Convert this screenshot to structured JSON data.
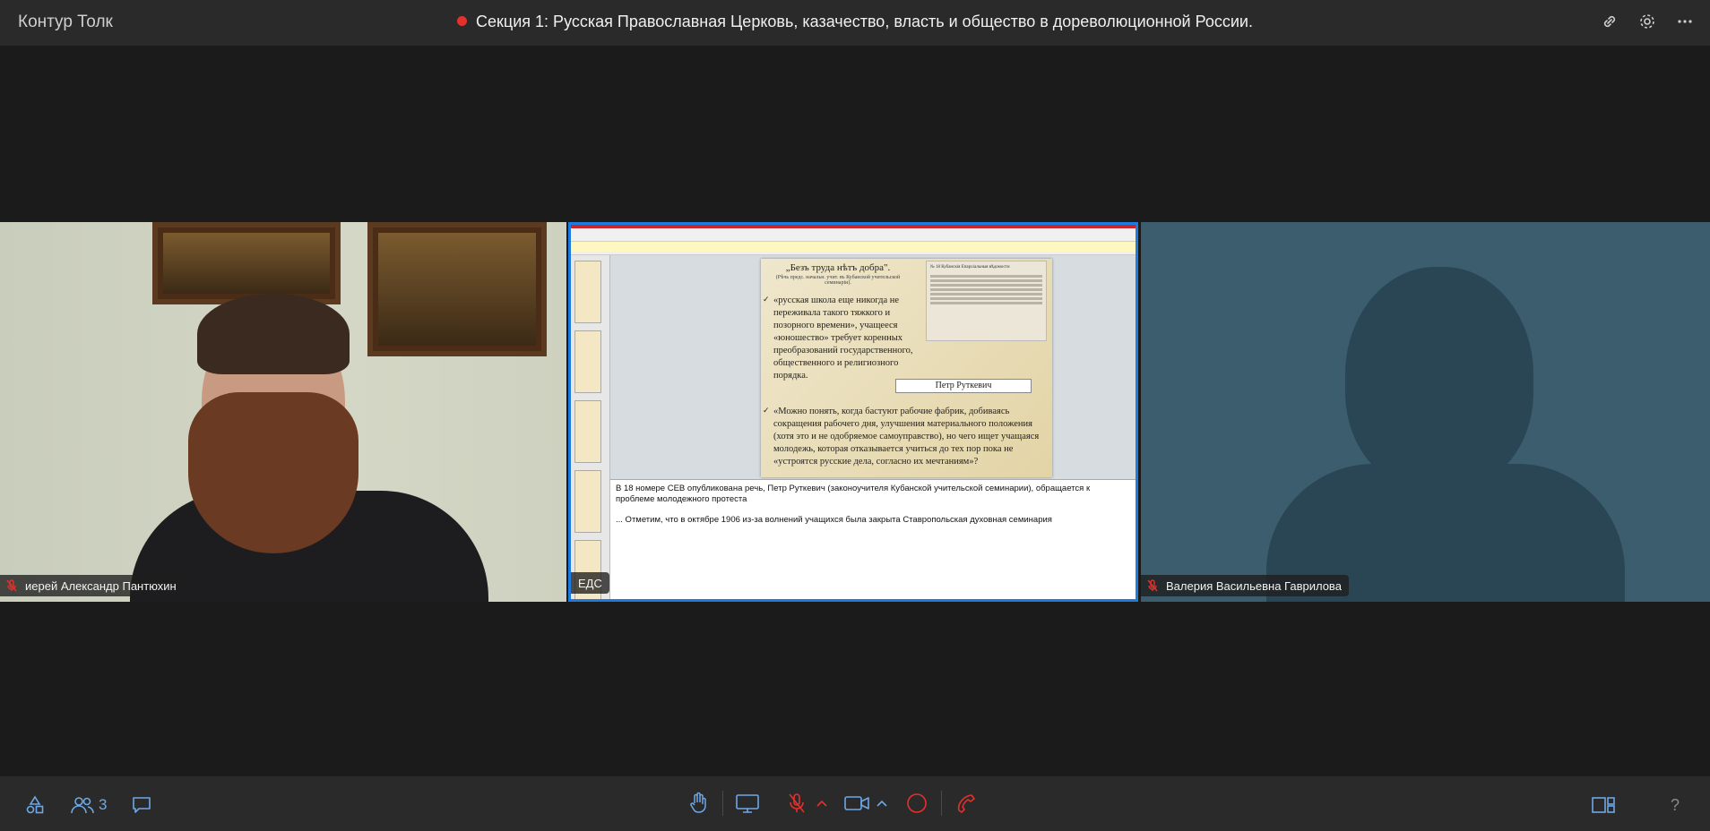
{
  "app": {
    "title": "Контур Толк"
  },
  "meeting": {
    "title": "Секция 1: Русская Православная Церковь, казачество, власть и общество в дореволюционной России.",
    "recording": true
  },
  "participants": {
    "count": "3",
    "tiles": [
      {
        "name": "иерей Александр Пантюхин",
        "mic": "muted"
      },
      {
        "name": "ЕДС",
        "mic": "on",
        "sharing": true
      },
      {
        "name": "Валерия Васильевна Гаврилова",
        "mic": "muted"
      }
    ]
  },
  "shared_slide": {
    "title": "„Безъ труда нѣтъ добра\".",
    "subtitle": "(Рѣчь предс. начальн. учит. въ Кубанской учительской семинаріи).",
    "newspaper_title": "№ 18 Кубанскія Епархіальныя вѣдомости",
    "quote1": "«русская школа еще никогда не переживала такого тяжкого и позорного времени», учащееся «юношество» требует коренных преобразований государственного, общественного и религиозного порядка.",
    "author": "Петр Руткевич",
    "quote2": "«Можно понять, когда бастуют рабочие фабрик, добиваясь сокращения рабочего дня, улучшения материального положения (хотя это и не одобряемое самоуправство), но чего ищет учащаяся молодежь, которая отказывается учиться до тех пор пока не «устроятся русские дела, согласно их мечтаниям»?"
  },
  "notes": {
    "line1": "В 18 номере СЕВ опубликована речь, Петр Руткевич (законоучителя Кубанской учительской семинарии), обращается к проблеме молодежного протеста",
    "line2": "... Отметим, что в октябре 1906 из-за волнений учащихся была закрыта Ставропольская духовная семинария"
  },
  "colors": {
    "accent": "#1f7ae0",
    "danger": "#e5302b",
    "icon_blue": "#6ea8e8"
  }
}
